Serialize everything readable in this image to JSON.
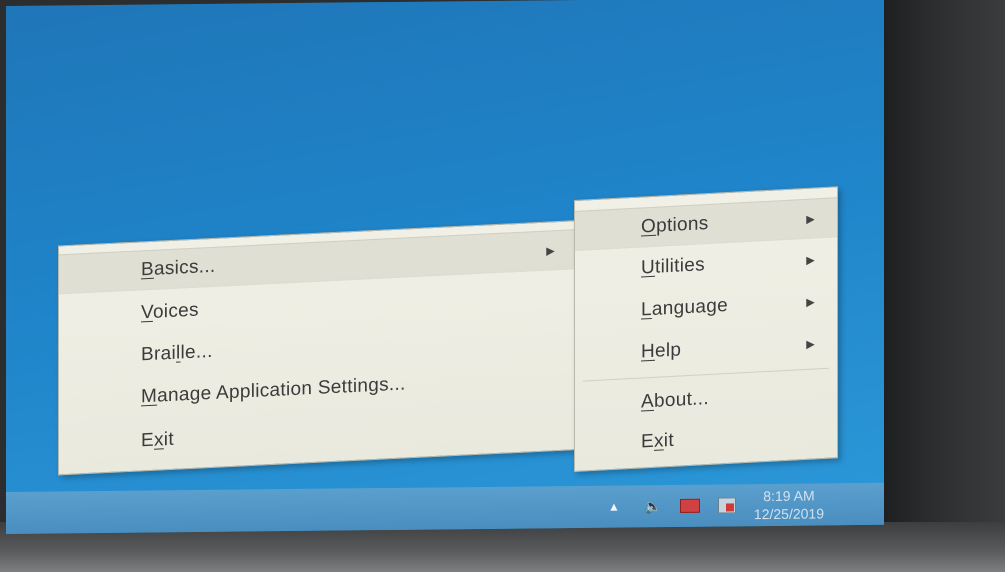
{
  "submenu": {
    "items": [
      {
        "pre": "",
        "key": "B",
        "post": "asics...",
        "has_arrow": true
      },
      {
        "pre": "",
        "key": "V",
        "post": "oices",
        "has_arrow": false
      },
      {
        "pre": "Brai",
        "key": "l",
        "post": "le...",
        "has_arrow": false
      },
      {
        "pre": "",
        "key": "M",
        "post": "anage Application Settings...",
        "has_arrow": false
      },
      {
        "pre": "E",
        "key": "x",
        "post": "it",
        "has_arrow": false
      }
    ]
  },
  "context": {
    "items": [
      {
        "pre": "",
        "key": "O",
        "post": "ptions",
        "has_arrow": true
      },
      {
        "pre": "",
        "key": "U",
        "post": "tilities",
        "has_arrow": true
      },
      {
        "pre": "",
        "key": "L",
        "post": "anguage",
        "has_arrow": true
      },
      {
        "pre": "",
        "key": "H",
        "post": "elp",
        "has_arrow": true
      },
      {
        "pre": "",
        "key": "A",
        "post": "bout...",
        "has_arrow": false
      },
      {
        "pre": "E",
        "key": "x",
        "post": "it",
        "has_arrow": false
      }
    ]
  },
  "tray": {
    "time": "8:19 AM",
    "date": "12/25/2019",
    "icons": [
      "chevron-up-icon",
      "speaker-icon",
      "network-icon",
      "action-center-flag-icon"
    ]
  },
  "colors": {
    "desktop": "#1f84c9",
    "menu_bg": "#f0f0e6",
    "menu_text": "#3b3b3b"
  }
}
